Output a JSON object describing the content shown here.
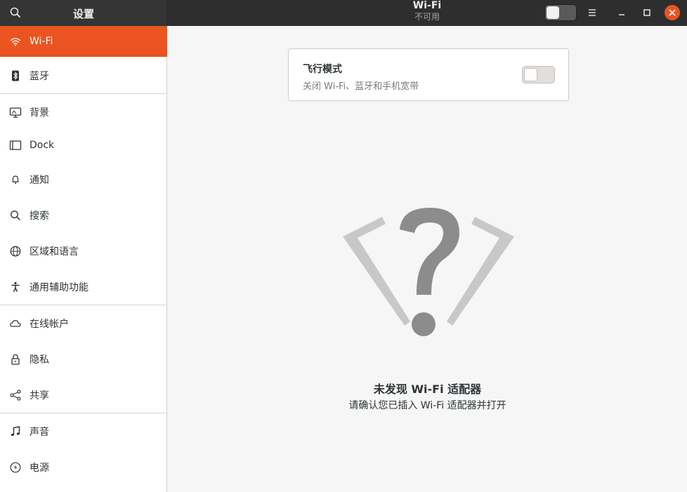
{
  "header": {
    "sidebar_title": "设置",
    "title": "Wi-Fi",
    "subtitle": "不可用",
    "wifi_switch_on": false,
    "close_color": "#e95420"
  },
  "sidebar": {
    "active_color": "#e95420",
    "items": [
      {
        "label": "Wi-Fi",
        "icon": "wifi-icon",
        "active": true
      },
      {
        "label": "蓝牙",
        "icon": "bluetooth-icon"
      },
      {
        "label": "背景",
        "icon": "background-icon"
      },
      {
        "label": "Dock",
        "icon": "dock-icon"
      },
      {
        "label": "通知",
        "icon": "bell-icon"
      },
      {
        "label": "搜索",
        "icon": "search-icon"
      },
      {
        "label": "区域和语言",
        "icon": "globe-icon"
      },
      {
        "label": "通用辅助功能",
        "icon": "accessibility-icon"
      },
      {
        "label": "在线帐户",
        "icon": "cloud-icon"
      },
      {
        "label": "隐私",
        "icon": "lock-icon"
      },
      {
        "label": "共享",
        "icon": "share-icon"
      },
      {
        "label": "声音",
        "icon": "music-note-icon"
      },
      {
        "label": "电源",
        "icon": "power-icon"
      }
    ]
  },
  "airplane": {
    "title": "飞行模式",
    "subtitle": "关闭 Wi-Fi、蓝牙和手机宽带",
    "enabled": false
  },
  "empty_state": {
    "icon": "question-mark-icon",
    "title": "未发现 Wi-Fi 适配器",
    "subtitle": "请确认您已插入 Wi-Fi 适配器并打开"
  }
}
